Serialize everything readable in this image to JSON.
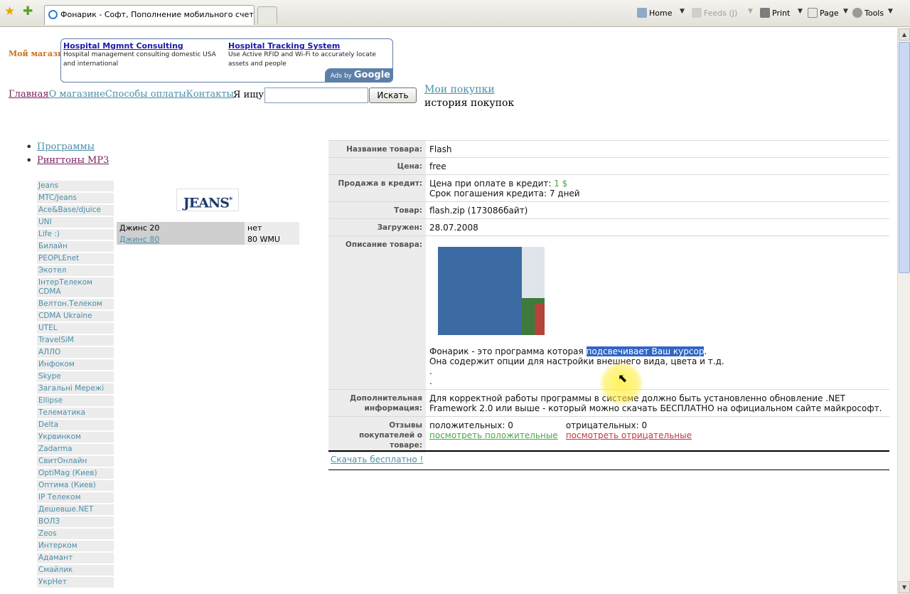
{
  "toolbar": {
    "tab_title": "Фонарик - Софт, Пополнение мобильного счета, Ц...",
    "home": "Home",
    "feeds": "Feeds (J)",
    "print": "Print",
    "page": "Page",
    "tools": "Tools"
  },
  "header": {
    "shop_title": "Мой магазин",
    "ads": [
      {
        "title": "Hospital Mgmnt Consulting",
        "desc": "Hospital management consulting domestic USA and international"
      },
      {
        "title": "Hospital Tracking System",
        "desc": "Use Active RFID and Wi-Fi to accurately locate assets and people"
      }
    ],
    "ads_by": "Ads by",
    "ads_google": "Google"
  },
  "nav": {
    "links": [
      "Главная",
      "О магазине",
      "Способы оплаты",
      "Контакты"
    ],
    "search_label": "Я ищу:",
    "search_value": "",
    "search_button": "Искать",
    "my_purchases": "Мои покупки",
    "purchase_history": "история покупок"
  },
  "categories": [
    "Программы",
    "Рингтоны MP3"
  ],
  "sidebar": [
    "Jeans",
    "MTC/Jeans",
    "Ace&Base/djuice",
    "UNI",
    "Life :)",
    "Билайн",
    "PEOPLEnet",
    "Экотел",
    "IнтерТелеком CDMA",
    "Велтон.Телеком",
    "CDMA Ukraine",
    "UTEL",
    "TravelSiM",
    "АЛЛО",
    "Инфоком",
    "Skype",
    "Загальні Мережі",
    "Ellipse",
    "Телематика",
    "Delta",
    "Укрвинком",
    "Zadarma",
    "СвитОнлайн",
    "OptiMag (Киев)",
    "Оптима (Киев)",
    "IP Телеком",
    "Дешевше.NET",
    "ВОЛЗ",
    "Zeos",
    "Интерком",
    "Адамант",
    "Смайлик",
    "УкрНет"
  ],
  "jeans": {
    "logo": "JEANS",
    "logo_mark": "*",
    "rows": [
      {
        "name": "Джинс 20",
        "price": "нет"
      },
      {
        "name": "Джинс 80",
        "price": "80 WMU"
      }
    ]
  },
  "product": {
    "name_label": "Название товара:",
    "name": "Flash",
    "price_label": "Цена:",
    "price": "free",
    "credit_label": "Продажа в кредит:",
    "credit_price_text": "Цена при оплате в кредит:",
    "credit_price": "1 $",
    "credit_term": "Срок погашения кредита: 7 дней",
    "file_label": "Товар:",
    "file": "flash.zip (173086байт)",
    "uploaded_label": "Загружен:",
    "uploaded": "28.07.2008",
    "desc_label": "Описание товара:",
    "desc_before": "Фонарик - это программа которая ",
    "desc_selected": "подсвечивает Ваш курсор",
    "desc_after": ".",
    "desc_line2": "Она содержит опции для настройки внешнего вида, цвета и т.д.",
    "desc_line3": ".",
    "desc_line4": ".",
    "extra_label": "Дополнительная информация:",
    "extra": "Для корректной работы программы в системе должно быть установленно обновление .NET Framework 2.0 или выше - который можно скачать БЕСПЛАТНО на официальном сайте майкрософт.",
    "reviews_label": "Отзывы покупателей о товаре:",
    "positive": "положительных: 0",
    "negative": "отрицательных: 0",
    "see_positive": "посмотреть положительные",
    "see_negative": "посмотреть отрицательные",
    "download": "Скачать бесплатно !"
  }
}
